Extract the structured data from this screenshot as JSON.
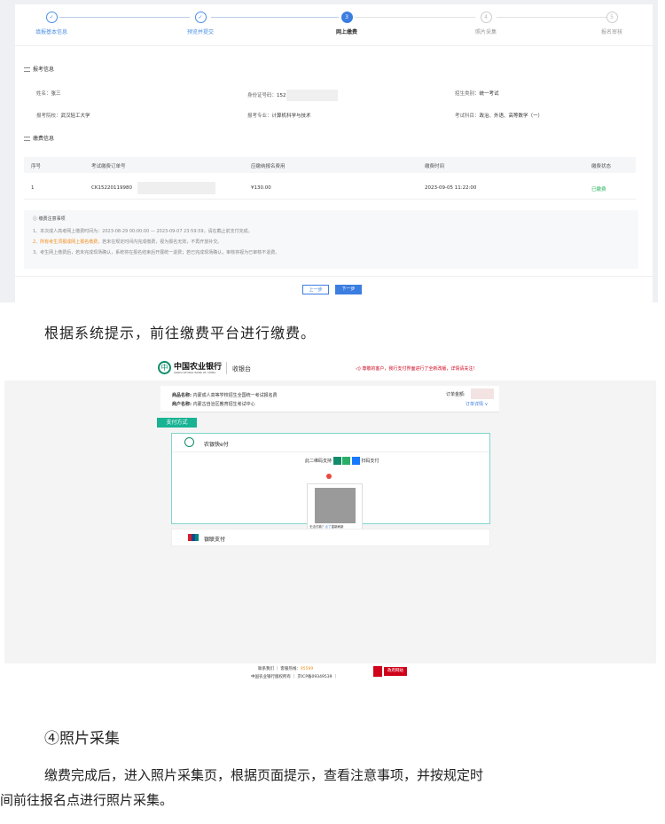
{
  "steps": [
    {
      "num": "✓",
      "label": "填报基本信息",
      "state": "done"
    },
    {
      "num": "✓",
      "label": "预览并提交",
      "state": "done"
    },
    {
      "num": "3",
      "label": "网上缴费",
      "state": "active"
    },
    {
      "num": "4",
      "label": "照片采集",
      "state": "todo"
    },
    {
      "num": "5",
      "label": "报名审核",
      "state": "todo"
    }
  ],
  "info": {
    "section_title": "报考信息",
    "name_label": "姓名：",
    "name_value": "张三",
    "id_label": "身份证号码：",
    "id_value": "152",
    "category_label": "招生类别：",
    "category_value": "统一考试",
    "school_label": "报考院校：",
    "school_value": "武汉轻工大学",
    "major_label": "报考专业：",
    "major_value": "计算机科学与技术",
    "subjects_label": "考试科目：",
    "subjects_value": "政治、外语、高等数学（一）"
  },
  "payment": {
    "section_title": "缴费信息",
    "columns": [
      "序号",
      "考试缴费订单号",
      "应缴纳报名费用",
      "缴费时间",
      "缴费状态"
    ],
    "row": {
      "index": "1",
      "order_no": "CK15220119980",
      "amount": "¥130.00",
      "time": "2023-09-05 11:22:00",
      "status": "已缴费"
    }
  },
  "notice": {
    "title": "缴费注意事项",
    "line1": "1、本次成人高考网上缴费时间为：2023-08-29 00:00:00 — 2023-09-07 23:59:59，请在截止前支付完成。",
    "line2a": "2、所有考生须报成网上报名缴费，",
    "line2b": "若未在规定时间内完成缴费，视为报名无效，不再开放补交。",
    "line3": "3、考生网上缴费后，若未完成现场确认，系统将在报名结束后开展统一退费；若已完成现场确认，审核将视为已审核不退费。"
  },
  "buttons": {
    "prev": "上一步",
    "next": "下一步"
  },
  "para1": "根据系统提示，前往缴费平台进行缴费。",
  "bank": {
    "logo_cn": "中国农业银行",
    "logo_en": "AGRICULTURAL BANK OF CHINA",
    "cashier": "收银台",
    "announce": "尊敬的客户，我行支付界面进行了全新改版，详情请关注!",
    "merchant_label": "商品名称:",
    "merchant_value": "内蒙成人高等学校招生全国统一考试报名费",
    "shop_label": "商户名称:",
    "shop_value": "内蒙古自治区教育招生考试中心",
    "amount_label": "订单金额:",
    "detail": "订单详情 ∨",
    "pay_tab": "支付方式",
    "epay": "农银快e付",
    "scan_prefix": "此二维码支持",
    "scan_suffix": "扫码支付",
    "qr_help_a": "无法付款？",
    "qr_help_b": "点了",
    "qr_help_c": "重新刷新",
    "unionpay": "银联支付",
    "footer1a": "联系我们 ｜ 客服热线：",
    "footer1b": "95599",
    "footer2": "中国农业银行版权所有 ｜ 京ICP备09349539 ｜",
    "badge": "政府网站"
  },
  "heading": "④照片采集",
  "para2_line1": "缴费完成后，进入照片采集页，根据页面提示，查看注意事项，并按规定时",
  "para2_line2": "间前往报名点进行照片采集。",
  "colors": {
    "accent": "#3b7de0",
    "paid": "#27b35a",
    "warn": "#f08c1b",
    "bank_green": "#118c6b",
    "announce_red": "#d0021b"
  }
}
